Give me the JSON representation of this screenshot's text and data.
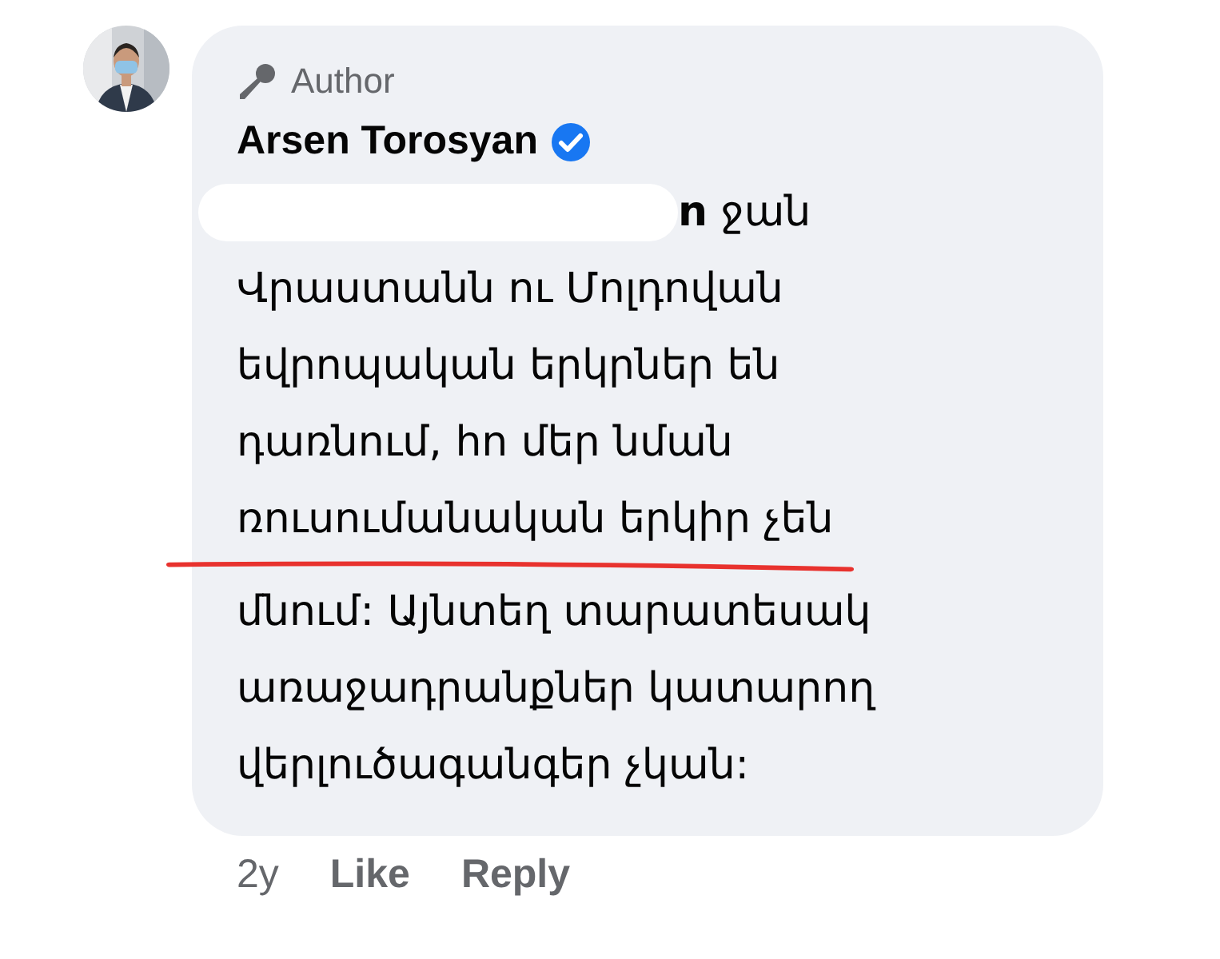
{
  "comment": {
    "badge": "Author",
    "author": "Arsen Torosyan",
    "verified": true,
    "lines": [
      "**n** ջան",
      "Վրաստանն ու Մոլդովան",
      "եվրոպական երկրներ են",
      "դառնում, հո մեր նման",
      "ռուսումանական երկիր չեն",
      "մնում: Այնտեղ տարատեսակ",
      "առաջադրանքներ կատարող",
      "վերլուծագանգեր չկան:"
    ],
    "time": "2y",
    "actions": [
      "Like",
      "Reply"
    ]
  }
}
